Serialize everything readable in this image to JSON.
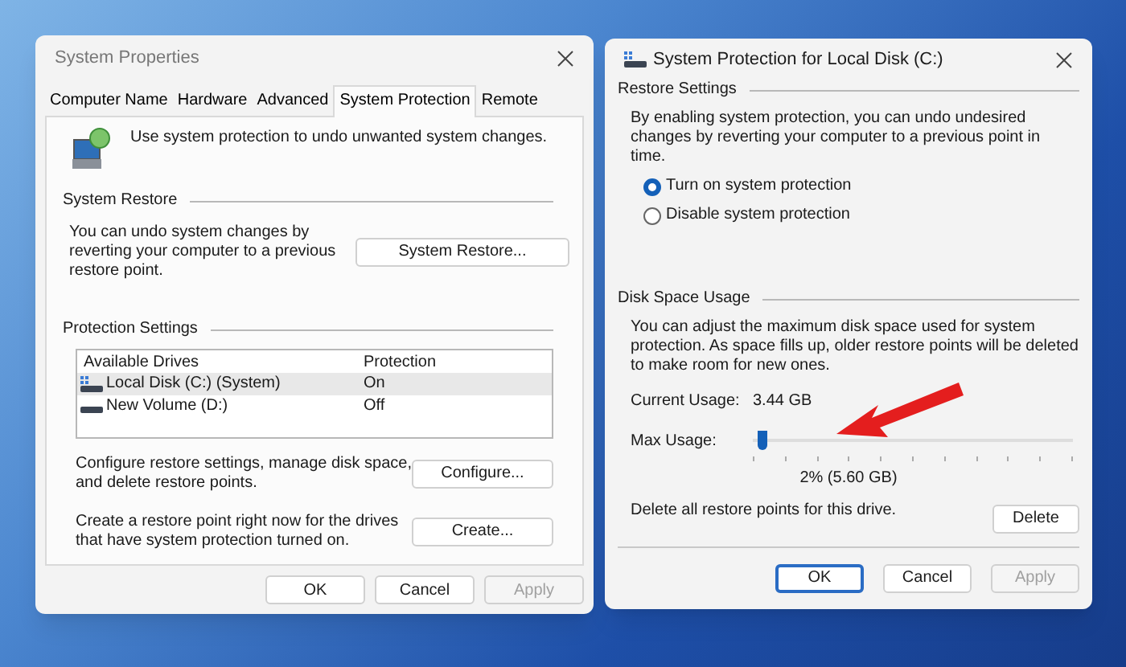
{
  "left_dialog": {
    "title": "System Properties",
    "tabs": [
      {
        "label": "Computer Name",
        "selected": false
      },
      {
        "label": "Hardware",
        "selected": false
      },
      {
        "label": "Advanced",
        "selected": false
      },
      {
        "label": "System Protection",
        "selected": true
      },
      {
        "label": "Remote",
        "selected": false
      }
    ],
    "intro": "Use system protection to undo unwanted system changes.",
    "system_restore": {
      "heading": "System Restore",
      "text": "You can undo system changes by reverting your computer to a previous restore point.",
      "button": "System Restore..."
    },
    "protection": {
      "heading": "Protection Settings",
      "columns": [
        "Available Drives",
        "Protection"
      ],
      "drives": [
        {
          "name": "Local Disk (C:) (System)",
          "protection": "On",
          "kind": "system",
          "selected": true
        },
        {
          "name": "New Volume (D:)",
          "protection": "Off",
          "kind": "plain",
          "selected": false
        }
      ]
    },
    "configure": {
      "text": "Configure restore settings, manage disk space, and delete restore points.",
      "button": "Configure..."
    },
    "create": {
      "text": "Create a restore point right now for the drives that have system protection turned on.",
      "button": "Create..."
    },
    "buttons": [
      {
        "label": "OK",
        "disabled": false
      },
      {
        "label": "Cancel",
        "disabled": false
      },
      {
        "label": "Apply",
        "disabled": true
      }
    ]
  },
  "right_dialog": {
    "title": "System Protection for Local Disk (C:)",
    "restore_settings": {
      "heading": "Restore Settings",
      "text": "By enabling system protection, you can undo undesired changes by reverting your computer to a previous point in time.",
      "options": [
        {
          "label": "Turn on system protection",
          "selected": true
        },
        {
          "label": "Disable system protection",
          "selected": false
        }
      ]
    },
    "disk_usage": {
      "heading": "Disk Space Usage",
      "text": "You can adjust the maximum disk space used for system protection. As space fills up, older restore points will be deleted to make room for new ones.",
      "current_label": "Current Usage:",
      "current_value": "3.44 GB",
      "max_label": "Max Usage:",
      "slider": {
        "level": 0.02
      },
      "slider_reading": "2% (5.60 GB)",
      "delete_text": "Delete all restore points for this drive.",
      "delete_button": "Delete"
    },
    "buttons": [
      {
        "label": "OK",
        "disabled": false,
        "default": true
      },
      {
        "label": "Cancel",
        "disabled": false,
        "default": false
      },
      {
        "label": "Apply",
        "disabled": true,
        "default": false
      }
    ]
  }
}
